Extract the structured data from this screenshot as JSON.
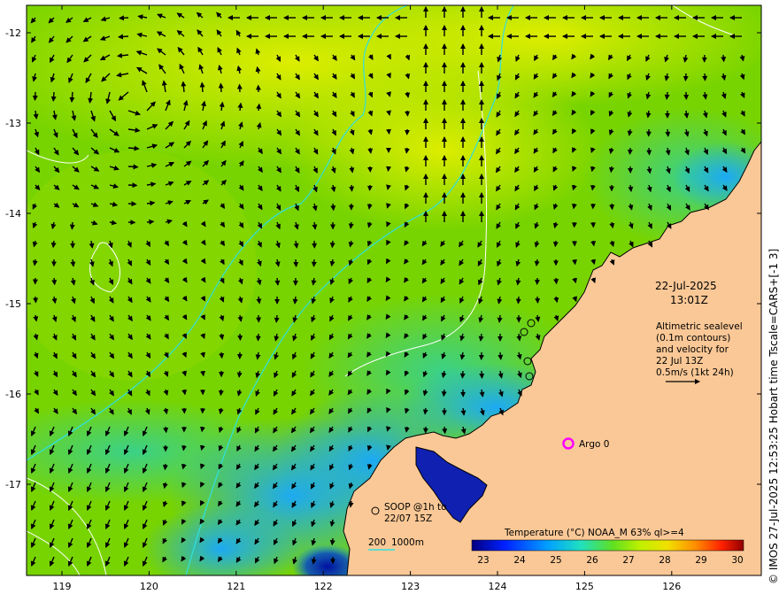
{
  "map": {
    "date": "22-Jul-2025",
    "time": "13:01Z",
    "altimetry_note": [
      "Altimetric sealevel",
      "(0.1m contours)",
      "and velocity for",
      "22 Jul 13Z",
      "0.5m/s (1kt 24h)"
    ],
    "argo_label": "Argo 0",
    "soop_label_line1": "SOOP @1h to",
    "soop_label_line2": "22/07 15Z",
    "isobath_label_a": "200",
    "isobath_label_b": "1000m",
    "side_caption": "© IMOS 27-Jul-2025 12:53:25 Hobart time  Tscale=CARS+[-1 3]",
    "colorbar_title": "Temperature (°C) NOAA_M 63% ql>=4",
    "colorbar_ticks": [
      "23",
      "24",
      "25",
      "26",
      "27",
      "28",
      "29",
      "30"
    ],
    "lat_ticks": [
      "-12",
      "-13",
      "-14",
      "-15",
      "-16",
      "-17"
    ],
    "lon_ticks": [
      "119",
      "120",
      "121",
      "122",
      "123",
      "124",
      "125",
      "126"
    ],
    "colors": {
      "land": "#fac896",
      "isobath": "#30e0e0",
      "argo": "#ff00ff",
      "sea_warm": "#b8e000",
      "sea_mid": "#6cd400",
      "sea_cool": "#20b8ff"
    }
  }
}
